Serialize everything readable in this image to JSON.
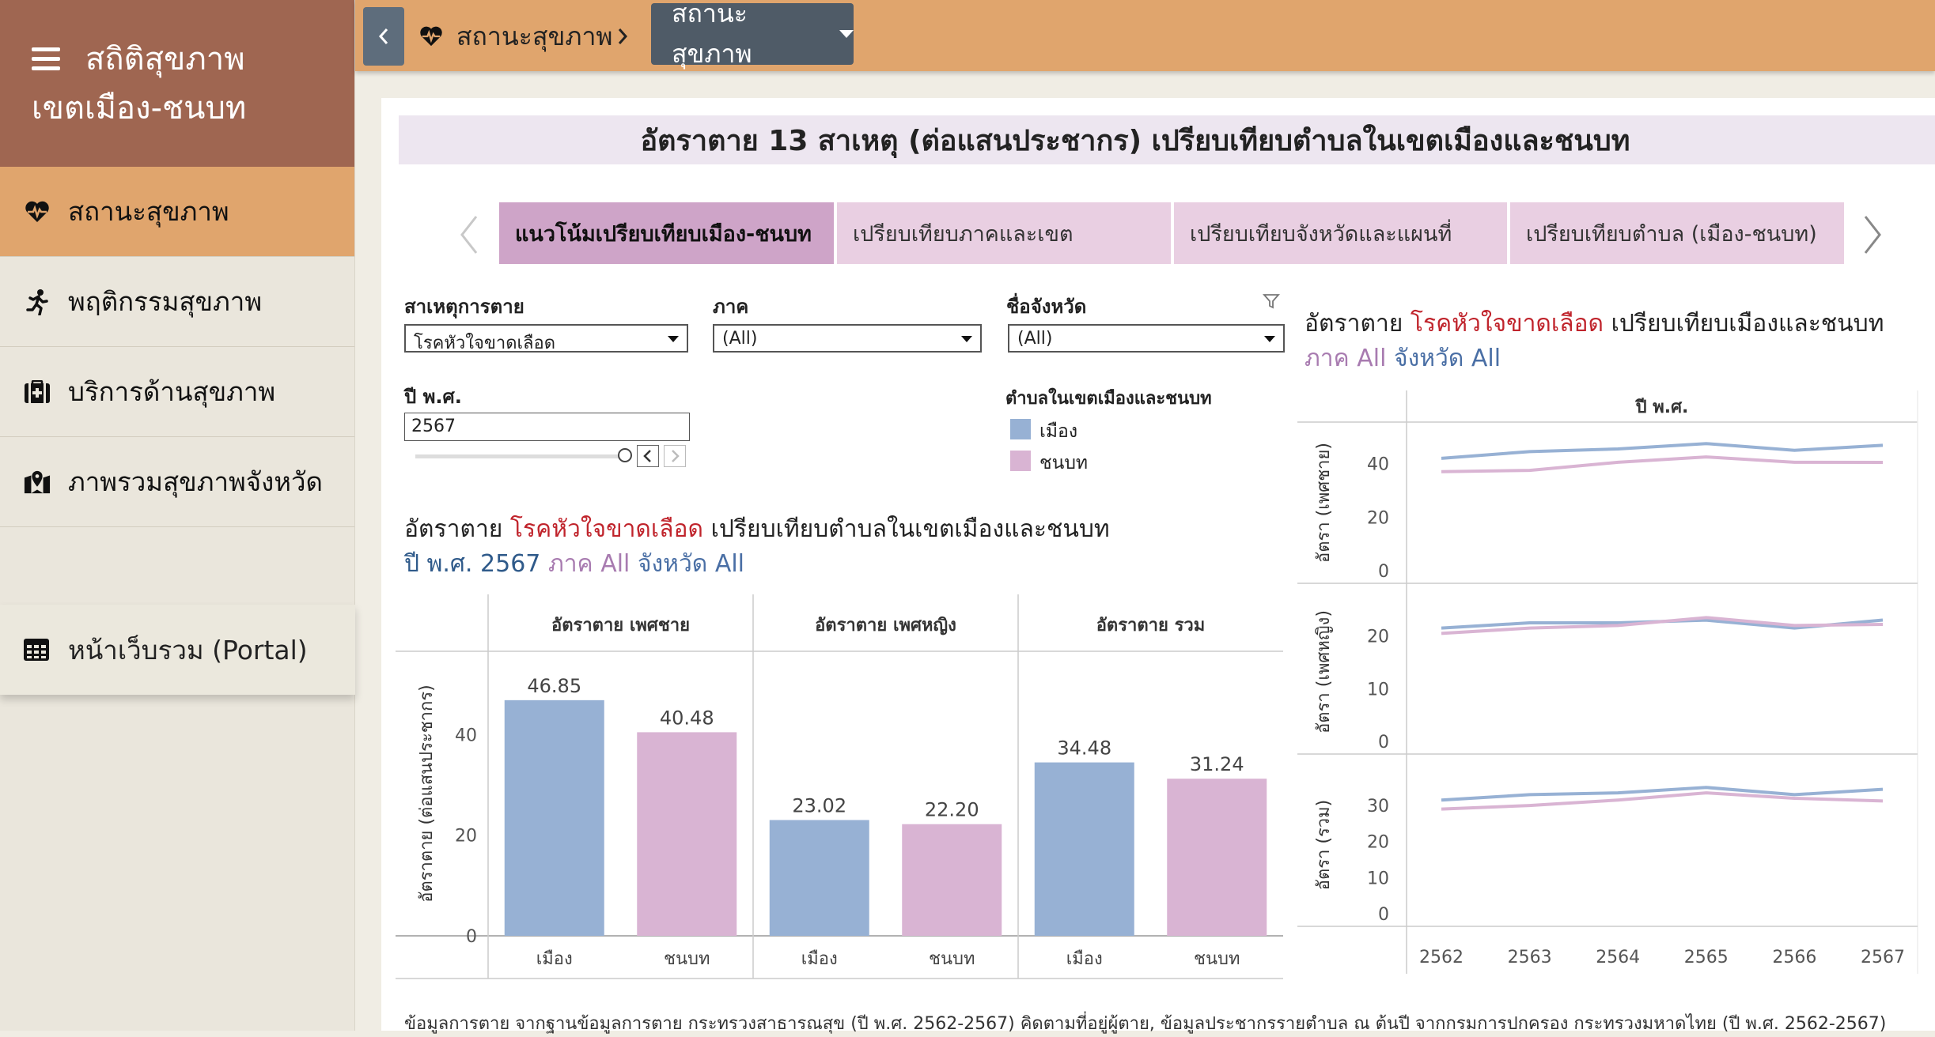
{
  "app": {
    "title_line1": "สถิติสุขภาพ",
    "title_line2": "เขตเมือง-ชนบท"
  },
  "sidebar": {
    "items": [
      {
        "label": "สถานะสุขภาพ",
        "icon": "heartbeat-icon"
      },
      {
        "label": "พฤติกรรมสุขภาพ",
        "icon": "running-icon"
      },
      {
        "label": "บริการด้านสุขภาพ",
        "icon": "medical-kit-icon"
      },
      {
        "label": "ภาพรวมสุขภาพจังหวัด",
        "icon": "map-pin-icon"
      }
    ],
    "portal": {
      "label": "หน้าเว็บรวม (Portal)",
      "icon": "grid-icon"
    }
  },
  "topbar": {
    "breadcrumb": "สถานะสุขภาพ",
    "dropdown": "สถานะสุขภาพ"
  },
  "dashboard": {
    "title": "อัตราตาย 13 สาเหตุ (ต่อแสนประชากร) เปรียบเทียบตำบลในเขตเมืองและชนบท",
    "tabs": [
      "แนวโน้มเปรียบเทียบเมือง-ชนบท",
      "เปรียบเทียบภาคและเขต",
      "เปรียบเทียบจังหวัดและแผนที่",
      "เปรียบเทียบตำบล (เมือง-ชนบท)"
    ],
    "filters": {
      "cause_label": "สาเหตุการตาย",
      "cause_value": "โรคหัวใจขาดเลือด",
      "region_label": "ภาค",
      "region_value": "(All)",
      "province_label": "ชื่อจังหวัด",
      "province_value": "(All)",
      "year_label": "ปี พ.ศ.",
      "year_value": "2567"
    },
    "legend": {
      "title": "ตำบลในเขตเมืองและชนบท",
      "urban": "เมือง",
      "rural": "ชนบท"
    },
    "colors": {
      "urban": "#97b1d4",
      "rural": "#d9b4d3",
      "cause": "#c0242c",
      "region": "#a87bb0",
      "province": "#4a6fa5",
      "year": "#2f5a8a"
    },
    "bar_title": {
      "prefix": "อัตราตาย",
      "cause": "โรคหัวใจขาดเลือด",
      "suffix": "เปรียบเทียบตำบลในเขตเมืองและชนบท",
      "year_label": "ปี พ.ศ.",
      "year": "2567",
      "region_label": "ภาค",
      "region": "All",
      "province_label": "จังหวัด",
      "province": "All"
    },
    "line_title": {
      "prefix": "อัตราตาย",
      "cause": "โรคหัวใจขาดเลือด",
      "suffix": "เปรียบเทียบเมืองและชนบท",
      "region_label": "ภาค",
      "region": "All",
      "province_label": "จังหวัด",
      "province": "All"
    },
    "footnote": "ข้อมูลการตาย จากฐานข้อมูลการตาย กระทรวงสาธารณสุข (ปี พ.ศ. 2562-2567) คิดตามที่อยู่ผู้ตาย, ข้อมูลประชากรรายตำบล ณ ต้นปี จากกรมการปกครอง กระทรวงมหาดไทย (ปี พ.ศ. 2562-2567)"
  },
  "chart_data": [
    {
      "type": "bar",
      "panels": [
        "อัตราตาย เพศชาย",
        "อัตราตาย เพศหญิง",
        "อัตราตาย รวม"
      ],
      "categories": [
        "เมือง",
        "ชนบท"
      ],
      "values": [
        [
          46.85,
          40.48
        ],
        [
          23.02,
          22.2
        ],
        [
          34.48,
          31.24
        ]
      ],
      "value_labels": [
        [
          "46.85",
          "40.48"
        ],
        [
          "23.02",
          "22.20"
        ],
        [
          "34.48",
          "31.24"
        ]
      ],
      "ylabel": "อัตราตาย (ต่อแสนประชากร)",
      "yticks": [
        "0",
        "20",
        "40"
      ],
      "ylim": [
        0,
        55
      ]
    },
    {
      "type": "line",
      "header": "ปี พ.ศ.",
      "x": [
        "2562",
        "2563",
        "2564",
        "2565",
        "2566",
        "2567"
      ],
      "panels": [
        {
          "ylabel": "อัตรา (เพศชาย)",
          "yticks": [
            "0",
            "20",
            "40"
          ],
          "ylim": [
            0,
            52
          ],
          "urban": [
            42,
            44.5,
            45.5,
            47.5,
            45,
            46.85
          ],
          "rural": [
            37,
            37.5,
            40.5,
            42.5,
            40.5,
            40.48
          ]
        },
        {
          "ylabel": "อัตรา (เพศหญิง)",
          "yticks": [
            "0",
            "10",
            "20"
          ],
          "ylim": [
            0,
            27
          ],
          "urban": [
            21.5,
            22.5,
            22.5,
            23,
            21.5,
            23.02
          ],
          "rural": [
            20.5,
            21.5,
            22,
            23.5,
            22,
            22.2
          ]
        },
        {
          "ylabel": "อัตรา (รวม)",
          "yticks": [
            "0",
            "10",
            "20",
            "30"
          ],
          "ylim": [
            0,
            39
          ],
          "urban": [
            31.5,
            33,
            33.5,
            35,
            33,
            34.48
          ],
          "rural": [
            29,
            30,
            31.5,
            33.5,
            32,
            31.24
          ]
        }
      ]
    }
  ]
}
